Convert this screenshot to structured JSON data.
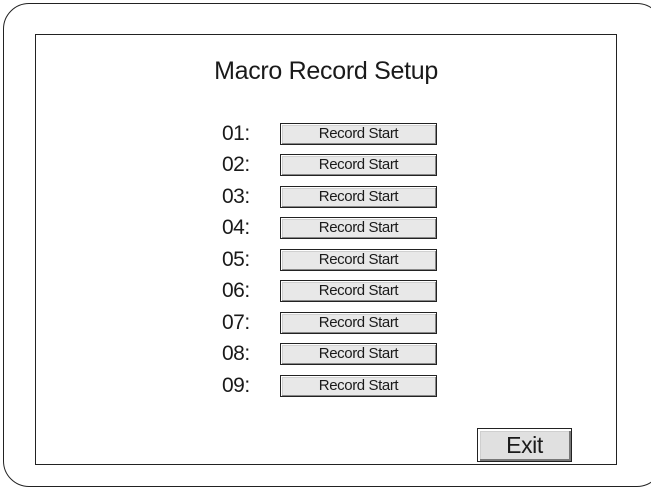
{
  "screen": {
    "title": "Macro Record Setup"
  },
  "macros": [
    {
      "slot": "01:",
      "button_label": "Record Start"
    },
    {
      "slot": "02:",
      "button_label": "Record Start"
    },
    {
      "slot": "03:",
      "button_label": "Record Start"
    },
    {
      "slot": "04:",
      "button_label": "Record Start"
    },
    {
      "slot": "05:",
      "button_label": "Record Start"
    },
    {
      "slot": "06:",
      "button_label": "Record Start"
    },
    {
      "slot": "07:",
      "button_label": "Record Start"
    },
    {
      "slot": "08:",
      "button_label": "Record Start"
    },
    {
      "slot": "09:",
      "button_label": "Record Start"
    }
  ],
  "footer": {
    "exit_label": "Exit"
  }
}
